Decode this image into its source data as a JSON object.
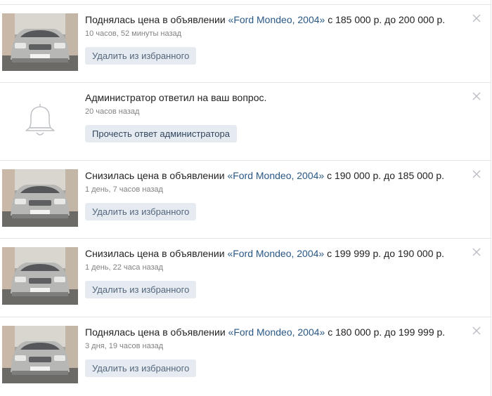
{
  "notifications": [
    {
      "type": "car",
      "text_before": "Поднялась цена в объявлении ",
      "link": "«Ford Mondeo, 2004»",
      "text_after": " с 185 000 р. до 200 000 р.",
      "time": "10 часов, 52 минуты назад",
      "button": "Удалить из избранного"
    },
    {
      "type": "bell",
      "text_before": "Администратор ответил на ваш вопрос.",
      "link": "",
      "text_after": "",
      "time": "20 часов назад",
      "button": "Прочесть ответ администратора"
    },
    {
      "type": "car",
      "text_before": "Снизилась цена в объявлении ",
      "link": "«Ford Mondeo, 2004»",
      "text_after": " с 190 000 р. до 185 000 р.",
      "time": "1 день, 7 часов назад",
      "button": "Удалить из избранного"
    },
    {
      "type": "car",
      "text_before": "Снизилась цена в объявлении ",
      "link": "«Ford Mondeo, 2004»",
      "text_after": " с 199 999 р. до 190 000 р.",
      "time": "1 день, 22 часа назад",
      "button": "Удалить из избранного"
    },
    {
      "type": "car",
      "text_before": "Поднялась цена в объявлении ",
      "link": "«Ford Mondeo, 2004»",
      "text_after": " с 180 000 р. до 199 999 р.",
      "time": "3 дня, 19 часов назад",
      "button": "Удалить из избранного"
    }
  ],
  "icons": {
    "close": "close-icon",
    "bell": "bell-icon",
    "car_photo": "car-photo"
  },
  "colors": {
    "link": "#2a5885",
    "button_bg": "#e5ebf1",
    "secondary_text": "#828282"
  }
}
